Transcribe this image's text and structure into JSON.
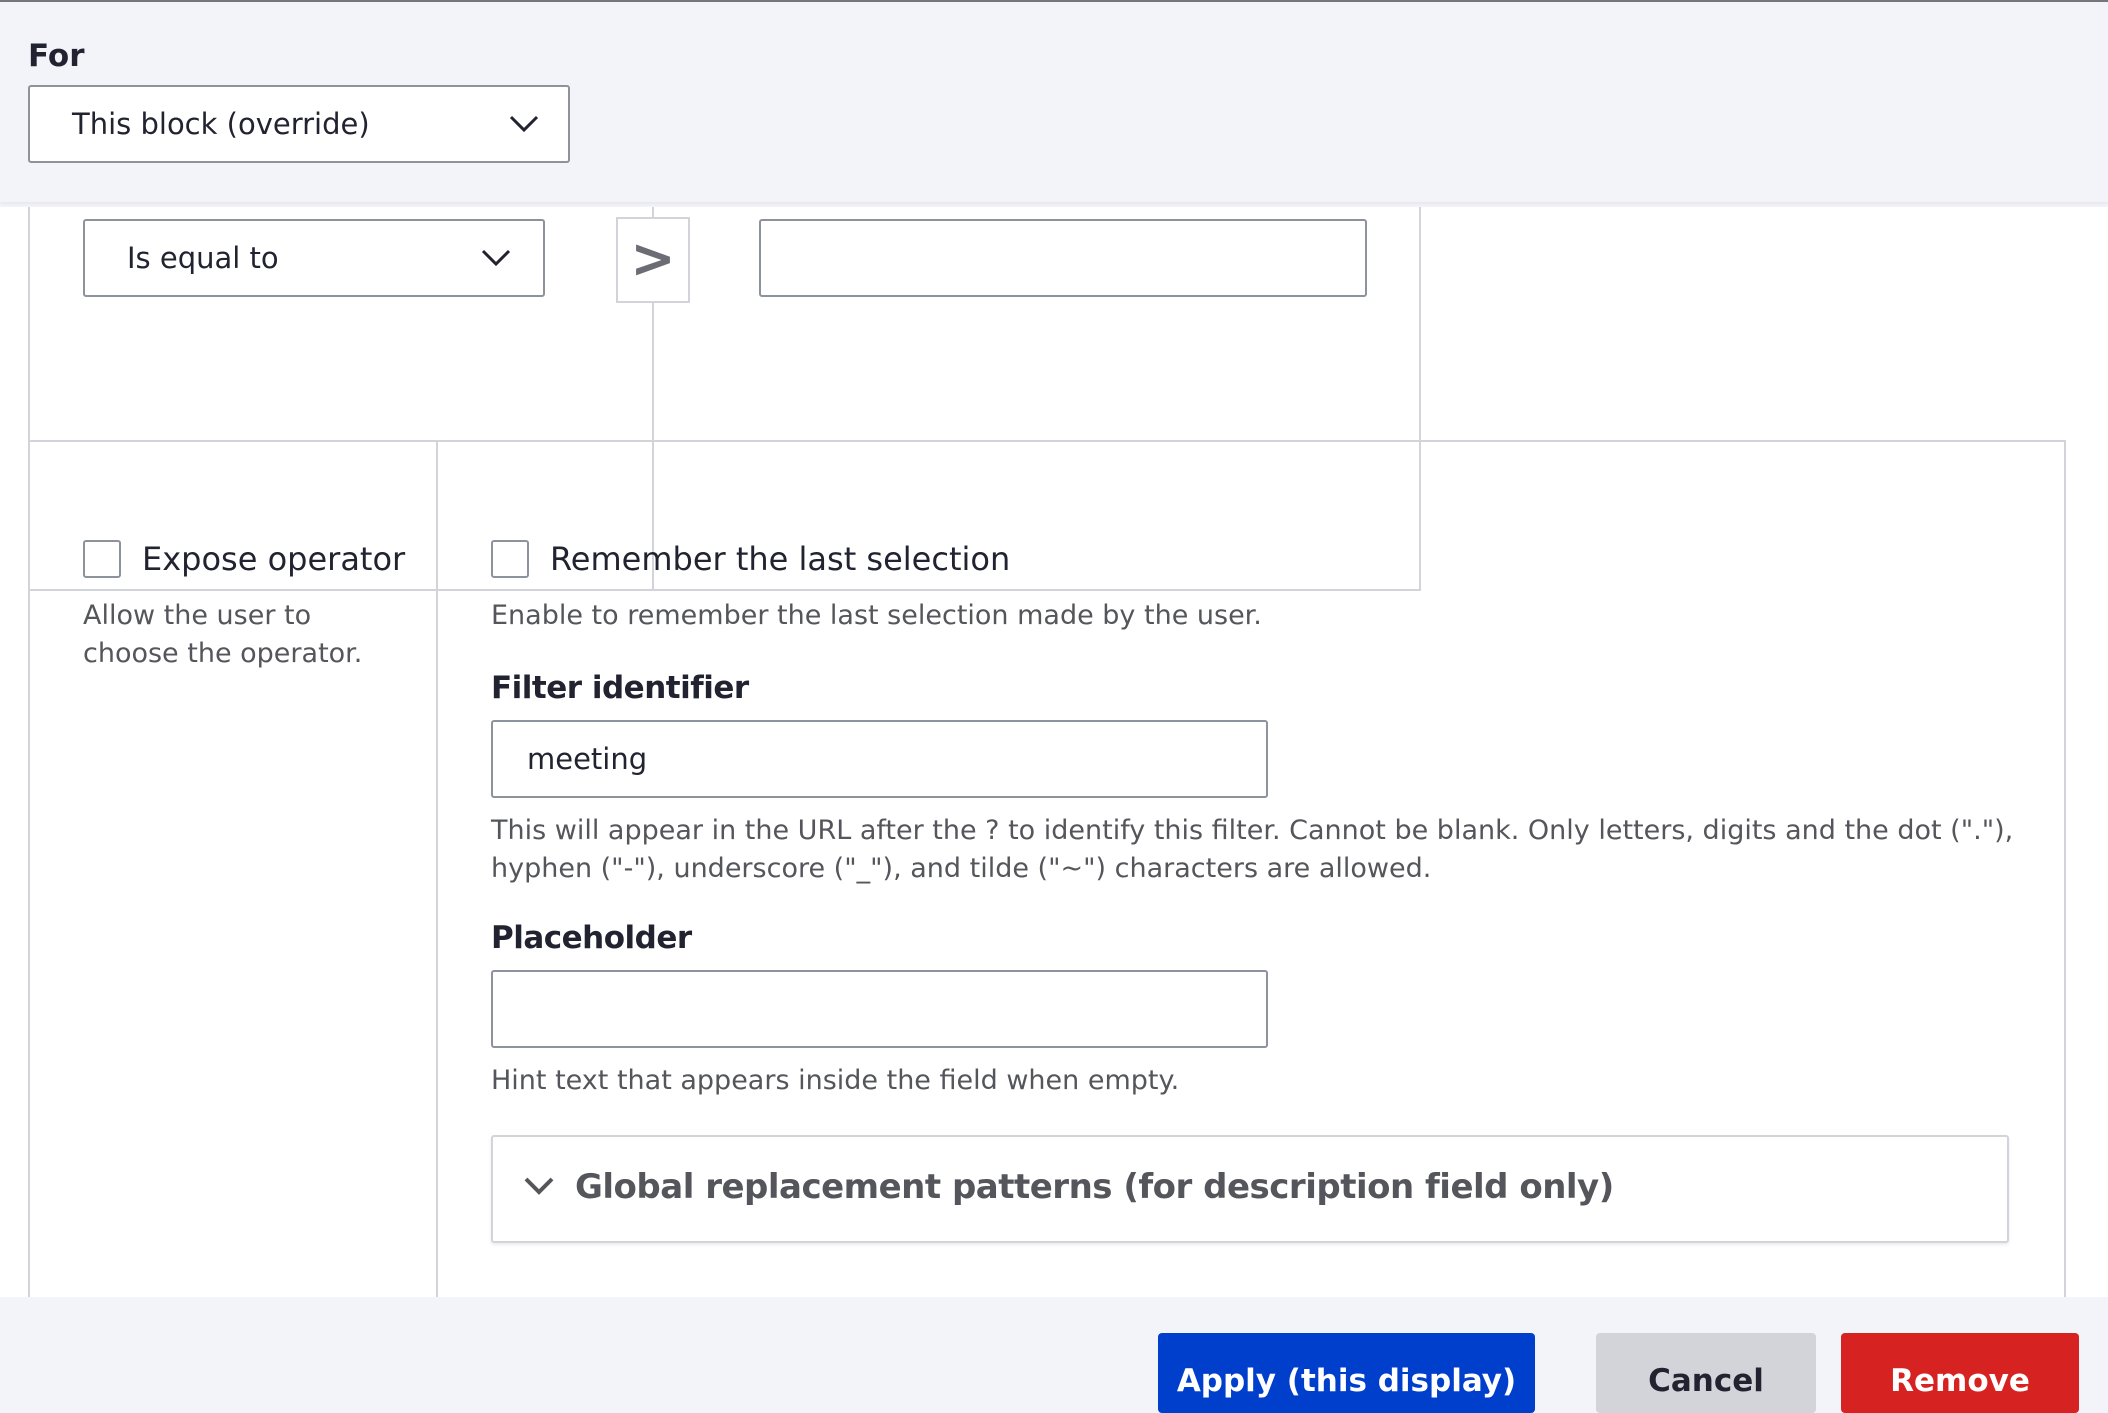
{
  "header": {
    "for_label": "For",
    "for_select_value": "This block (override)"
  },
  "operator_row": {
    "operator_select_value": "Is equal to",
    "arrow_label": ">",
    "value_input": ""
  },
  "expose": {
    "expose_operator_label": "Expose operator",
    "expose_operator_checked": false,
    "expose_operator_description": [
      "Allow the user to",
      "choose the operator."
    ],
    "remember_label": "Remember the last selection",
    "remember_checked": false,
    "remember_description": "Enable to remember the last selection made by the user.",
    "filter_identifier_label": "Filter identifier",
    "filter_identifier_value": "meeting",
    "filter_identifier_description": [
      "This will appear in the URL after the ? to identify this filter. Cannot be blank. Only letters, digits and the dot (\".\"),",
      "hyphen (\"-\"), underscore (\"_\"), and tilde (\"~\") characters are allowed."
    ],
    "placeholder_label": "Placeholder",
    "placeholder_value": "",
    "placeholder_description": "Hint text that appears inside the field when empty.",
    "global_patterns_summary": "Global replacement patterns (for description field only)"
  },
  "footer": {
    "apply_label": "Apply (this display)",
    "cancel_label": "Cancel",
    "remove_label": "Remove"
  },
  "colors": {
    "apply": "#003ecc",
    "cancel": "#d3d4d9",
    "remove": "#d72222",
    "header_bg": "#f3f4f9"
  }
}
